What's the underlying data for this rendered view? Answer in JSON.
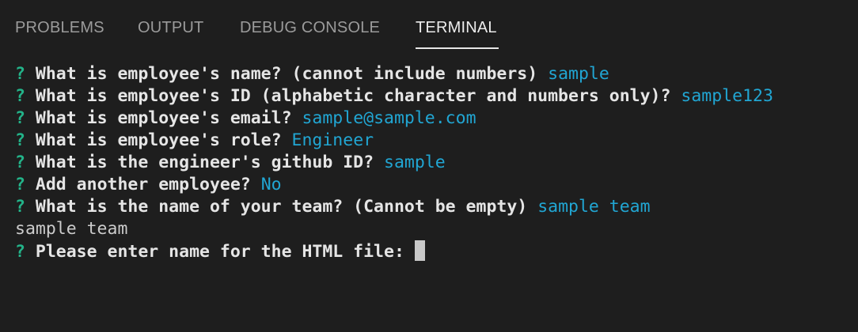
{
  "tabs": [
    {
      "label": "PROBLEMS",
      "active": false
    },
    {
      "label": "OUTPUT",
      "active": false
    },
    {
      "label": "DEBUG CONSOLE",
      "active": false
    },
    {
      "label": "TERMINAL",
      "active": true
    }
  ],
  "terminal": {
    "lines": [
      {
        "marker": "?",
        "prompt": "What is employee's name? (cannot include numbers)",
        "answer": "sample"
      },
      {
        "marker": "?",
        "prompt": "What is employee's ID (alphabetic character and numbers only)?",
        "answer": "sample123"
      },
      {
        "marker": "?",
        "prompt": "What is employee's email?",
        "answer": "sample@sample.com"
      },
      {
        "marker": "?",
        "prompt": "What is employee's role?",
        "answer": "Engineer"
      },
      {
        "marker": "?",
        "prompt": "What is the engineer's github ID?",
        "answer": "sample"
      },
      {
        "marker": "?",
        "prompt": "Add another employee?",
        "answer": "No"
      },
      {
        "marker": "?",
        "prompt": "What is the name of your team? (Cannot be empty)",
        "answer": "sample team"
      }
    ],
    "output_line": "sample team",
    "current_prompt": {
      "marker": "?",
      "prompt": "Please enter name for the HTML file:",
      "input": ""
    }
  },
  "colors": {
    "background": "#1e1e1e",
    "marker": "#23b389",
    "answer": "#21a6d3",
    "active_tab": "#ececec",
    "inactive_tab": "#9b9b9b"
  }
}
